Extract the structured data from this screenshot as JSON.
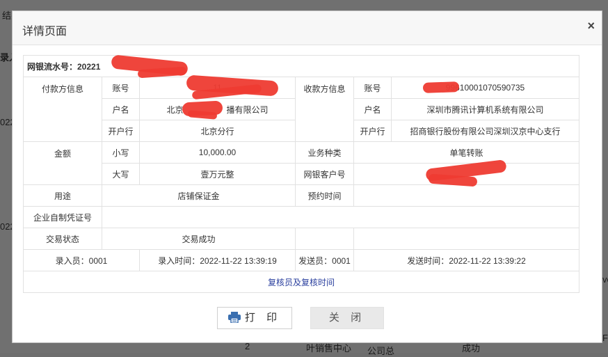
{
  "background": {
    "fragments": [
      "结果页面",
      "录入",
      "022",
      "022",
      "2",
      "叶销售中心",
      "公司总",
      "成功",
      "ve",
      "F"
    ]
  },
  "dialog": {
    "title": "详情页面",
    "close_symbol": "×"
  },
  "detail": {
    "serial_label": "网银流水号：20221",
    "payer": {
      "section_label": "付款方信息",
      "account_label": "账号",
      "account_value": "11",
      "name_label": "户名",
      "name_value_prefix": "北京",
      "name_value_suffix": "播有限公司",
      "bank_label": "开户行",
      "bank_value": "北京分行"
    },
    "payee": {
      "section_label": "收款方信息",
      "account_label": "账号",
      "account_value": "99610001070590735",
      "name_label": "户名",
      "name_value": "深圳市腾讯计算机系统有限公司",
      "bank_label": "开户行",
      "bank_value": "招商银行股份有限公司深圳汉京中心支行"
    },
    "amount": {
      "label": "金额",
      "small_label": "小写",
      "small_value": "10,000.00",
      "big_label": "大写",
      "big_value": "壹万元整"
    },
    "business_type_label": "业务种类",
    "business_type_value": "单笔转账",
    "ebank_customer_label": "网银客户号",
    "purpose_label": "用途",
    "purpose_value": "店铺保证金",
    "schedule_label": "预约时间",
    "voucher_label": "企业自制凭证号",
    "status_label": "交易状态",
    "status_value": "交易成功",
    "entry_operator": "录入员：0001",
    "entry_time": "录入时间：2022-11-22 13:39:19",
    "sender": "发送员：0001",
    "send_time": "发送时间：2022-11-22 13:39:22",
    "reviewer_link": "复核员及复核时间"
  },
  "buttons": {
    "print_label": "打 印",
    "close_label": "关 闭"
  },
  "colors": {
    "redaction": "#ee3b32",
    "link": "#2a3f9e"
  }
}
